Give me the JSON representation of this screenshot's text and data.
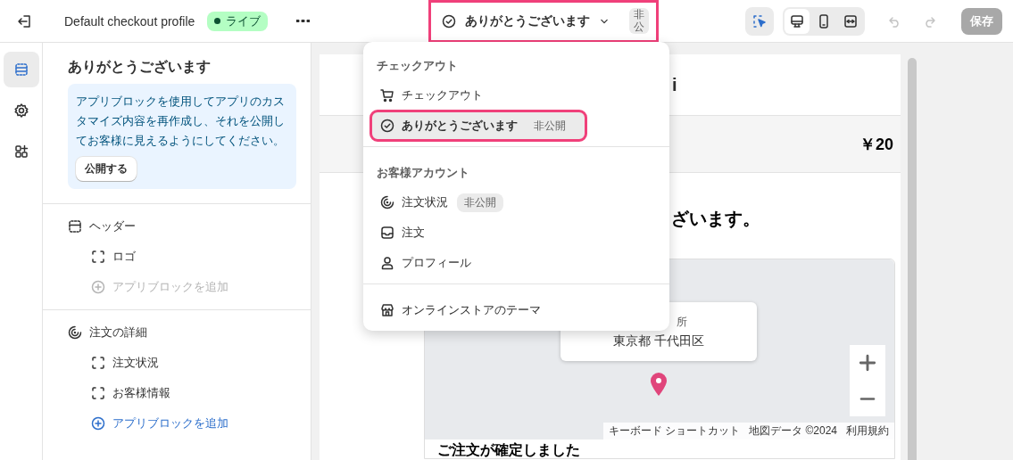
{
  "topbar": {
    "profile": "Default checkout profile",
    "status": {
      "label": "ライブ",
      "color": "#0c5132"
    },
    "page_selector": {
      "label": "ありがとうございます",
      "badge": "非公",
      "highlighted": true
    },
    "save": {
      "label": "保存",
      "disabled": true
    },
    "undo_disabled": true,
    "redo_disabled": true,
    "inspector_on": true,
    "views": [
      {
        "kind": "desktop",
        "selected": true
      },
      {
        "kind": "mobile",
        "selected": false
      },
      {
        "kind": "full",
        "selected": false
      }
    ]
  },
  "rail": [
    {
      "kind": "sections",
      "selected": true
    },
    {
      "kind": "settings",
      "selected": false
    },
    {
      "kind": "apps",
      "selected": false
    }
  ],
  "sidebar": {
    "title": "ありがとうございます",
    "notice": {
      "text": "アプリブロックを使用してアプリのカスタマイズ内容を再作成し、それを公開してお客様に見えるようにしてください。",
      "button": "公開する"
    },
    "sections": [
      {
        "title": "ヘッダー",
        "kind": "header",
        "items": [
          {
            "kind": "block",
            "label": "ロゴ",
            "disabled": false
          },
          {
            "kind": "add",
            "label": "アプリブロックを追加",
            "disabled": true
          }
        ]
      },
      {
        "title": "注文の詳細",
        "kind": "status",
        "items": [
          {
            "kind": "block",
            "label": "注文状況",
            "disabled": false
          },
          {
            "kind": "block",
            "label": "お客様情報",
            "disabled": false
          },
          {
            "kind": "add",
            "label": "アプリブロックを追加",
            "disabled": false
          }
        ]
      }
    ]
  },
  "dropdown": {
    "groups": [
      {
        "heading": "チェックアウト",
        "items": [
          {
            "kind": "cart",
            "label": "チェックアウト",
            "selected": false,
            "highlighted": false
          },
          {
            "kind": "check",
            "label": "ありがとうございます",
            "badge": "非公開",
            "selected": true,
            "highlighted": true
          }
        ]
      },
      {
        "heading": "お客様アカウント",
        "items": [
          {
            "kind": "status",
            "label": "注文状況",
            "badge": "非公開",
            "selected": false,
            "highlighted": false
          },
          {
            "kind": "inbox",
            "label": "注文",
            "selected": false,
            "highlighted": false
          },
          {
            "kind": "person",
            "label": "プロフィール",
            "selected": false,
            "highlighted": false
          }
        ]
      },
      {
        "items": [
          {
            "kind": "store",
            "label": "オンラインストアのテーマ",
            "selected": false,
            "highlighted": false
          }
        ]
      }
    ]
  },
  "preview": {
    "shop_name": "i",
    "total": "￥20",
    "heading": "ざいます。",
    "map": {
      "callout_line_1": "所",
      "callout_line_2": "東京都 千代田区",
      "attribution": [
        "キーボード ショートカット",
        "地図データ ©2024",
        "利用規約"
      ]
    },
    "confirmation": "ご注文が確定しました"
  }
}
